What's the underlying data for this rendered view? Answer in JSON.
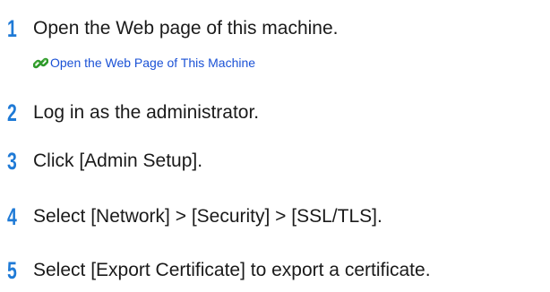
{
  "steps": [
    {
      "number": "1",
      "text": "Open the Web page of this machine."
    },
    {
      "number": "2",
      "text": "Log in as the administrator."
    },
    {
      "number": "3",
      "text": "Click [Admin Setup]."
    },
    {
      "number": "4",
      "text": "Select [Network] > [Security] > [SSL/TLS]."
    },
    {
      "number": "5",
      "text": "Select [Export Certificate] to export a certificate."
    }
  ],
  "link": {
    "icon": "chain-link-icon",
    "text": "Open the Web Page of This Machine"
  },
  "colors": {
    "step_number": "#1f7ad6",
    "link": "#1b52d6",
    "icon_green": "#2e9a2a"
  }
}
